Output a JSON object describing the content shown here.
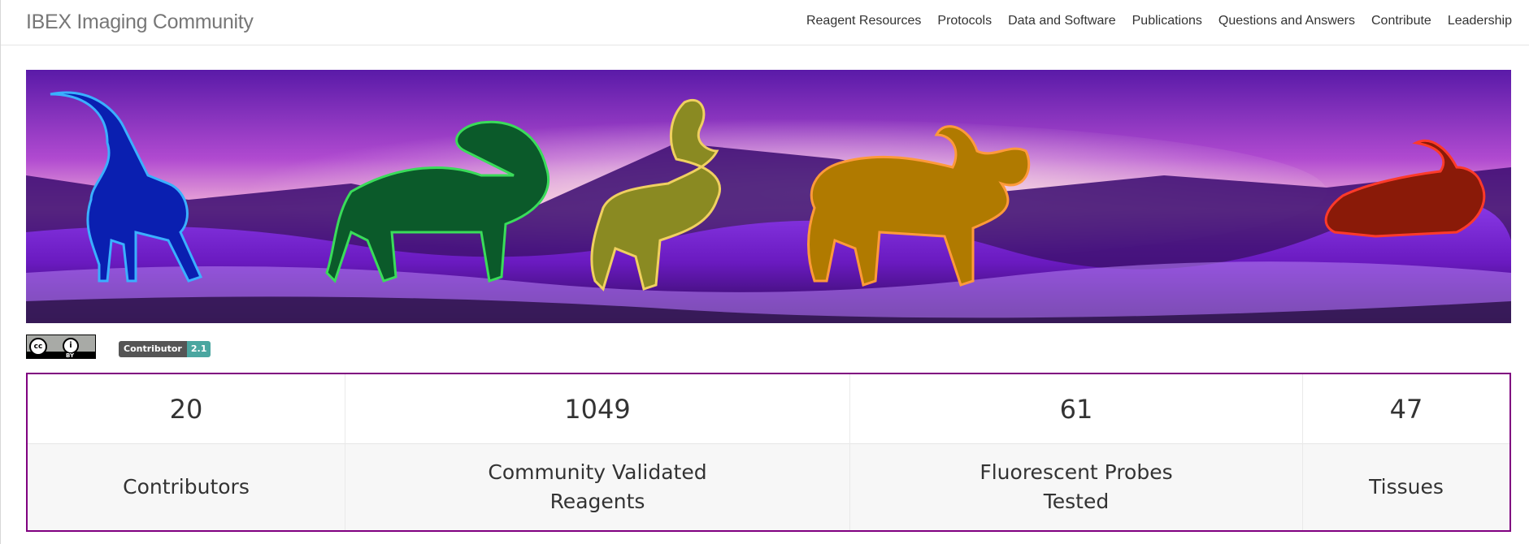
{
  "brand": "IBEX Imaging Community",
  "nav": [
    "Reagent Resources",
    "Protocols",
    "Data and Software",
    "Publications",
    "Questions and Answers",
    "Contribute",
    "Leadership"
  ],
  "badges": {
    "cc": {
      "cc_text": "cc",
      "by_text": "BY"
    },
    "covenant": {
      "label": "Contributor Covenant",
      "version": "2.1"
    }
  },
  "stats": [
    {
      "value": "20",
      "label": "Contributors"
    },
    {
      "value": "1049",
      "label": "Community Validated Reagents"
    },
    {
      "value": "61",
      "label": "Fluorescent Probes Tested"
    },
    {
      "value": "47",
      "label": "Tissues"
    }
  ],
  "colors": {
    "stats_border": "#800080",
    "ibex_blue": "#0a1fb0",
    "ibex_green": "#0b5a2a",
    "ibex_olive": "#8a8a22",
    "ibex_orange": "#b07a00",
    "ibex_red": "#8a1a08"
  }
}
